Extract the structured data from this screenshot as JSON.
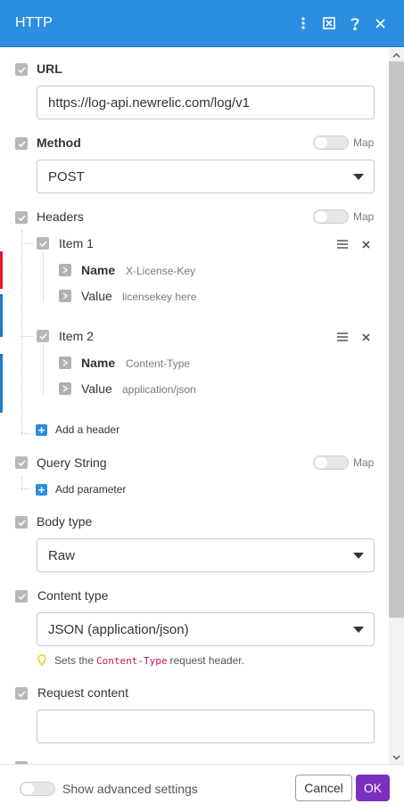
{
  "header": {
    "title": "HTTP",
    "icons": [
      "more-vertical-icon",
      "expand-icon",
      "help-icon",
      "close-icon"
    ],
    "color": "#2b8ee0"
  },
  "url": {
    "label": "URL",
    "value": "https://log-api.newrelic.com/log/v1"
  },
  "method": {
    "label": "Method",
    "map_label": "Map",
    "value": "POST"
  },
  "headers": {
    "label": "Headers",
    "map_label": "Map",
    "items": [
      {
        "title": "Item 1",
        "name_label": "Name",
        "name_value": "X-License-Key",
        "value_label": "Value",
        "value_value": "licensekey here"
      },
      {
        "title": "Item 2",
        "name_label": "Name",
        "name_value": "Content-Type",
        "value_label": "Value",
        "value_value": "application/json"
      }
    ],
    "add_label": "Add a header"
  },
  "query_string": {
    "label": "Query String",
    "map_label": "Map",
    "add_label": "Add parameter"
  },
  "body_type": {
    "label": "Body type",
    "value": "Raw"
  },
  "content_type": {
    "label": "Content type",
    "value": "JSON (application/json)",
    "hint_prefix": "Sets the",
    "hint_code": "Content-Type",
    "hint_suffix": "request header."
  },
  "request_content": {
    "label": "Request content",
    "value": ""
  },
  "footer": {
    "advanced_label": "Show advanced settings",
    "cancel_label": "Cancel",
    "ok_label": "OK",
    "ok_color": "#7a2fbf"
  }
}
